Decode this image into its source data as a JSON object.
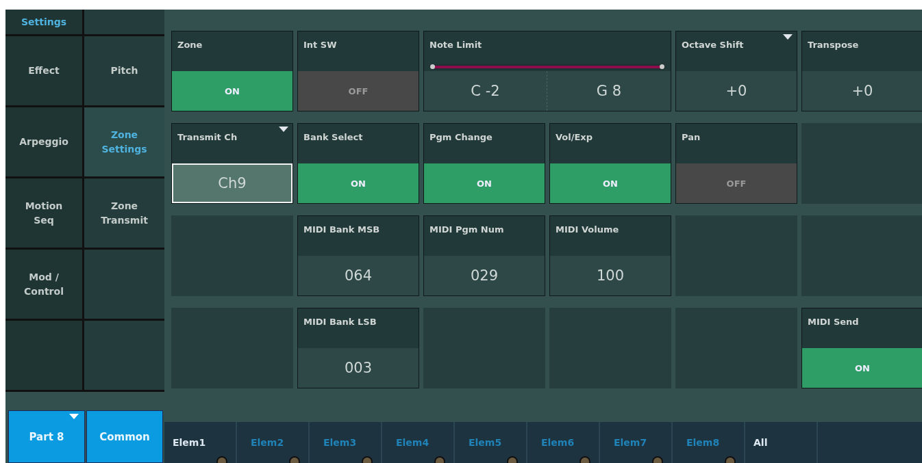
{
  "sidebar": {
    "rows": [
      [
        {
          "label": "Settings",
          "selected": true
        },
        null
      ],
      [
        {
          "label": "Effect",
          "selected": false
        },
        {
          "label": "Pitch",
          "selected": false
        }
      ],
      [
        {
          "label": "Arpeggio",
          "selected": false
        },
        {
          "label": "Zone Settings",
          "selected": true
        }
      ],
      [
        {
          "label": "Motion Seq",
          "selected": false
        },
        {
          "label": "Zone Transmit",
          "selected": false
        }
      ],
      [
        {
          "label": "Mod / Control",
          "selected": false
        },
        null
      ],
      [
        null,
        null
      ]
    ]
  },
  "grid": {
    "panels": [
      {
        "kind": "switch",
        "label": "Zone",
        "on": true,
        "text": "ON"
      },
      {
        "kind": "switch",
        "label": "Int SW",
        "on": false,
        "text": "OFF"
      },
      {
        "kind": "range",
        "label": "Note Limit",
        "level": 1,
        "low": "C -2",
        "high": "G 8"
      },
      {
        "kind": "value",
        "label": "Octave Shift",
        "value": "+0",
        "dropdown": true,
        "focused": false
      },
      {
        "kind": "value",
        "label": "Transpose",
        "value": "+0",
        "dropdown": false,
        "focused": false
      },
      {
        "kind": "value",
        "label": "Transmit Ch",
        "value": "Ch9",
        "dropdown": true,
        "focused": true
      },
      {
        "kind": "switch",
        "label": "Bank Select",
        "on": true,
        "text": "ON"
      },
      {
        "kind": "switch",
        "label": "Pgm Change",
        "on": true,
        "text": "ON"
      },
      {
        "kind": "switch",
        "label": "Vol/Exp",
        "on": true,
        "text": "ON"
      },
      {
        "kind": "switch",
        "label": "Pan",
        "on": false,
        "text": "OFF"
      },
      {
        "kind": "empty"
      },
      {
        "kind": "empty"
      },
      {
        "kind": "value",
        "label": "MIDI Bank MSB",
        "value": "064",
        "dropdown": false,
        "focused": false
      },
      {
        "kind": "value",
        "label": "MIDI Pgm Num",
        "value": "029",
        "dropdown": false,
        "focused": false
      },
      {
        "kind": "value",
        "label": "MIDI Volume",
        "value": "100",
        "dropdown": false,
        "focused": false
      },
      {
        "kind": "empty"
      },
      {
        "kind": "empty"
      },
      {
        "kind": "empty"
      },
      {
        "kind": "value",
        "label": "MIDI Bank LSB",
        "value": "003",
        "dropdown": false,
        "focused": false
      },
      {
        "kind": "empty"
      },
      {
        "kind": "empty"
      },
      {
        "kind": "empty"
      },
      {
        "kind": "switch",
        "label": "MIDI Send",
        "on": true,
        "text": "ON"
      }
    ]
  },
  "parts": [
    {
      "label": "Part 8",
      "dropdown": true
    },
    {
      "label": "Common",
      "dropdown": false
    }
  ],
  "elements": [
    {
      "kind": "element",
      "label": "Elem1",
      "on": true
    },
    {
      "kind": "element",
      "label": "Elem2",
      "on": false
    },
    {
      "kind": "element",
      "label": "Elem3",
      "on": false
    },
    {
      "kind": "element",
      "label": "Elem4",
      "on": false
    },
    {
      "kind": "element",
      "label": "Elem5",
      "on": false
    },
    {
      "kind": "element",
      "label": "Elem6",
      "on": false
    },
    {
      "kind": "element",
      "label": "Elem7",
      "on": false
    },
    {
      "kind": "element",
      "label": "Elem8",
      "on": false
    },
    {
      "kind": "all",
      "label": "All",
      "on": true
    }
  ]
}
